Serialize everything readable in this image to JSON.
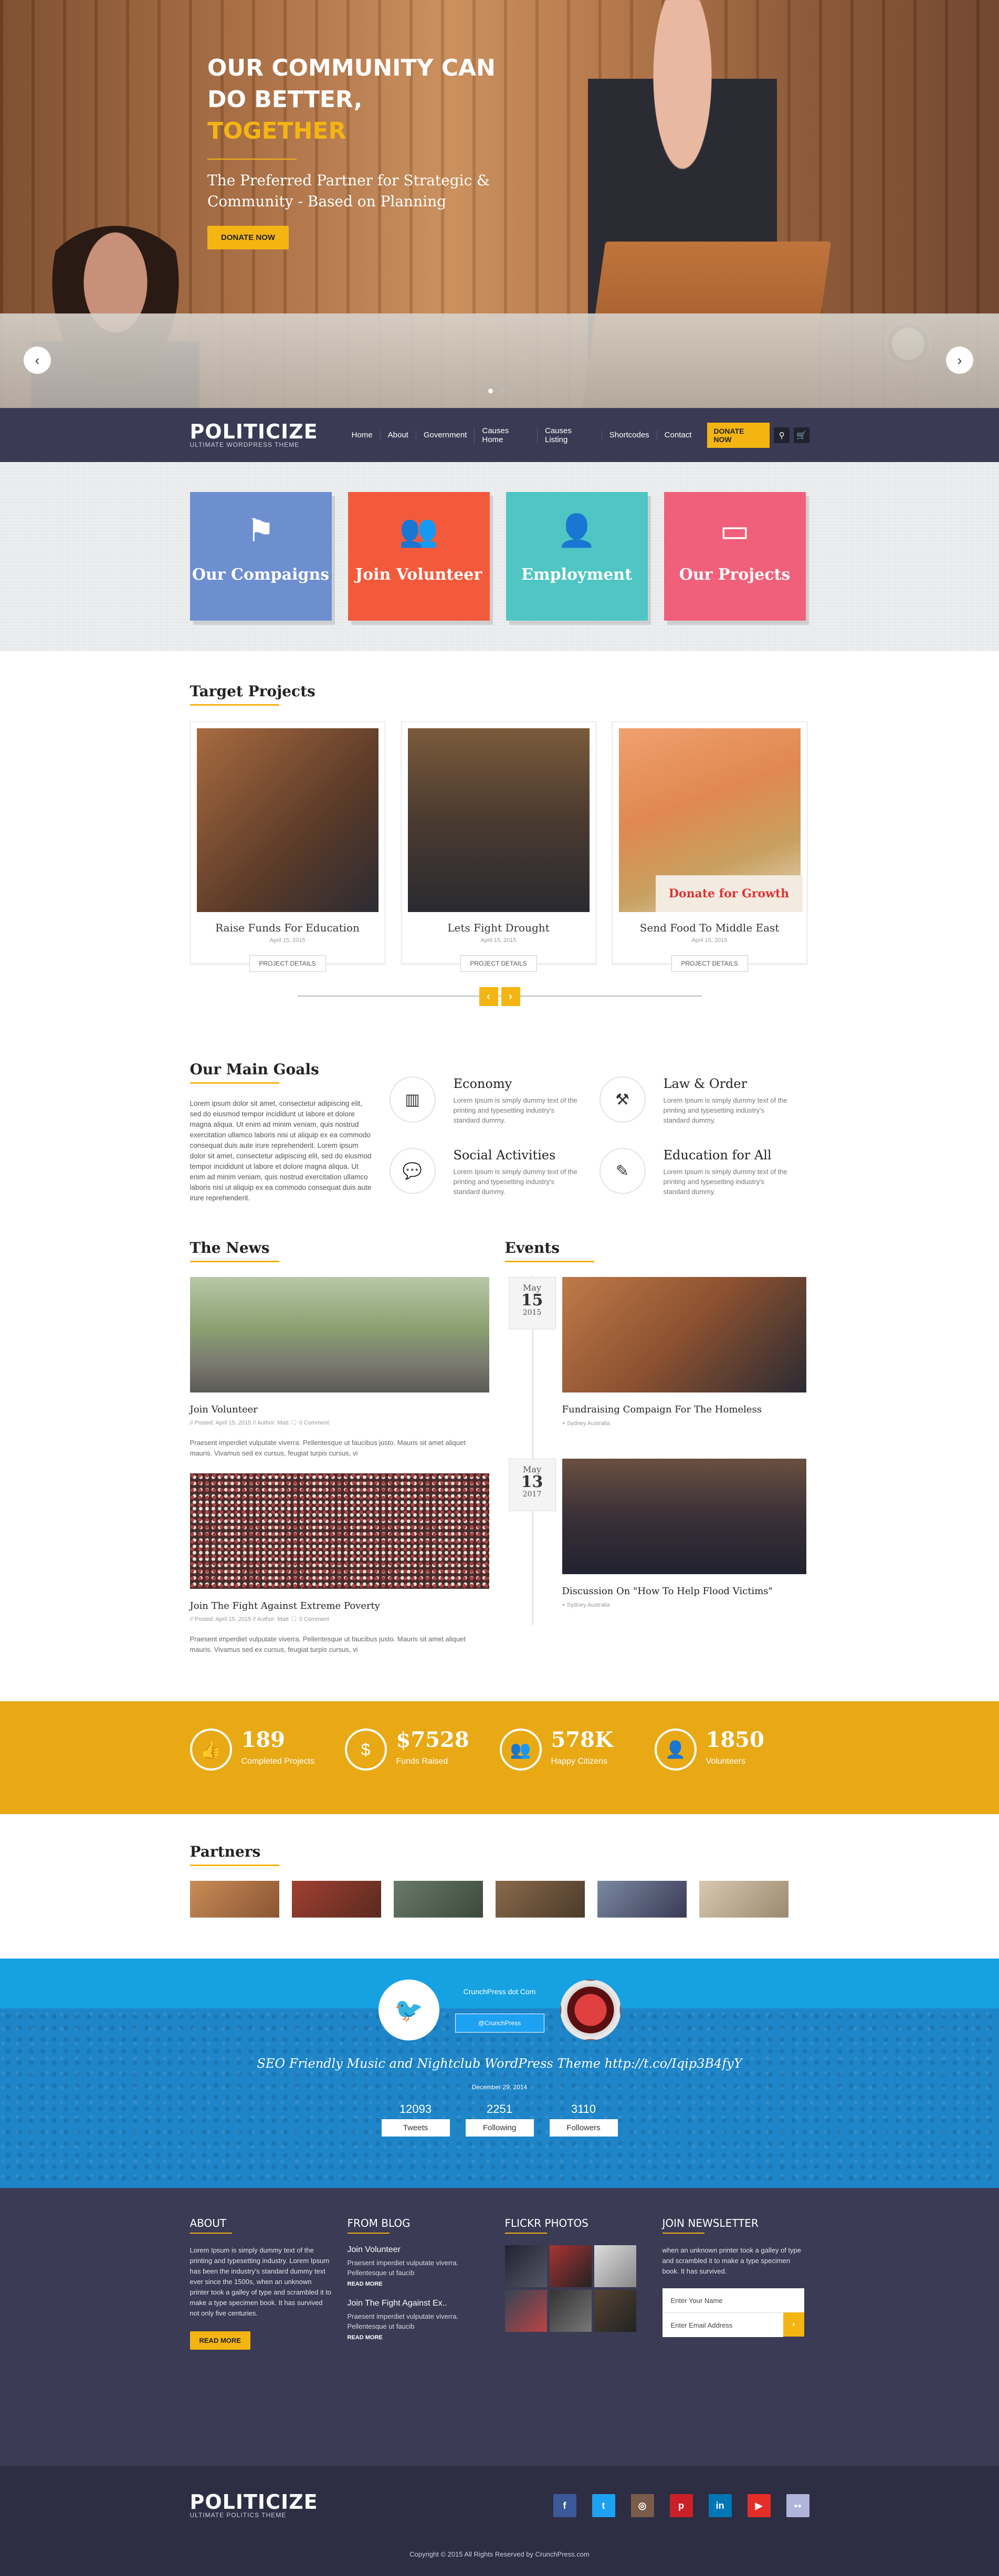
{
  "hero": {
    "title_line1": "OUR COMMUNITY CAN",
    "title_line2": "DO BETTER,",
    "title_accent": "TOGETHER",
    "subtitle": "The Preferred Partner for Strategic & Community - Based on Planning",
    "cta": "DONATE NOW",
    "prev_icon": "chevron-left-icon",
    "next_icon": "chevron-right-icon",
    "prev_glyph": "‹",
    "next_glyph": "›"
  },
  "nav": {
    "logo": "POLITICIZE",
    "tagline": "ULTIMATE WORDPRESS THEME",
    "items": [
      "Home",
      "About",
      "Government",
      "Causes Home",
      "Causes Listing",
      "Shortcodes",
      "Contact"
    ],
    "donate": "DONATE NOW",
    "search_glyph": "⚲",
    "cart_glyph": "🛒"
  },
  "features": [
    {
      "label": "Our Compaigns",
      "icon": "flag-icon",
      "glyph": "⚑",
      "color": "#6d8fd0"
    },
    {
      "label": "Join Volunteer",
      "icon": "group-icon",
      "glyph": "👥",
      "color": "#f35a3c"
    },
    {
      "label": "Employment",
      "icon": "user-tie-icon",
      "glyph": "👤",
      "color": "#4fc6c3"
    },
    {
      "label": "Our Projects",
      "icon": "credit-card-icon",
      "glyph": "▭",
      "color": "#f0607a"
    }
  ],
  "projects": {
    "title": "Target Projects",
    "items": [
      {
        "title": "Raise Funds For Education",
        "date": "April 15, 2015",
        "button": "PROJECT DETAILS"
      },
      {
        "title": "Lets Fight Drought",
        "date": "April 15, 2015",
        "button": "PROJECT DETAILS"
      },
      {
        "title": "Send Food To Middle East",
        "date": "April 15, 2015",
        "button": "PROJECT DETAILS",
        "overlay": "Donate for Growth"
      }
    ],
    "prev_glyph": "‹",
    "next_glyph": "›"
  },
  "goals": {
    "title": "Our Main Goals",
    "text": "Lorem ipsum dolor sit amet, consectetur adipiscing elit, sed do eiusmod tempor incididunt ut labore et dolore magna aliqua. Ut enim ad minim veniam, quis nostrud exercitation ullamco laboris nisi ut aliquip ex ea commodo consequat duis aute irure reprehenderit. Lorem ipsum dolor sit amet, consectetur adipiscing elit, sed do eiusmod tempor incididunt ut labore et dolore magna aliqua. Ut enim ad minim veniam, quis nostrud exercitation ullamco laboris nisi ut aliquip ex ea commodo consequat duis aute irure reprehenderit.",
    "items": [
      {
        "title": "Economy",
        "desc": "Lorem Ipsum is simply dummy text of the printing and typesetting industry's standard dummy.",
        "icon": "chart-icon",
        "glyph": "▥"
      },
      {
        "title": "Law & Order",
        "desc": "Lorem Ipsum is simply dummy text of the printing and typesetting industry's standard dummy.",
        "icon": "gavel-icon",
        "glyph": "⚒"
      },
      {
        "title": "Social Activities",
        "desc": "Lorem Ipsum is simply dummy text of the printing and typesetting industry's standard dummy.",
        "icon": "chat-icon",
        "glyph": "💬"
      },
      {
        "title": "Education for All",
        "desc": "Lorem Ipsum is simply dummy text of the printing and typesetting industry's standard dummy.",
        "icon": "pencil-icon",
        "glyph": "✎"
      }
    ]
  },
  "news": {
    "title": "The News",
    "items": [
      {
        "title": "Join Volunteer",
        "meta": "//  Posted: April 15, 2015   //  Author: Matt   🗨 0 Comment",
        "text": "Praesent imperdiet vulputate viverra. Pellentesque ut faucibus justo. Mauris sit amet aliquet mauris. Vivamus sed ex cursus, feugiat turpis cursus, vi"
      },
      {
        "title": "Join The Fight Against Extreme Poverty",
        "meta": "//  Posted: April 15, 2015   //  Author: Matt   🗨 0 Comment",
        "text": "Praesent imperdiet vulputate viverra. Pellentesque ut faucibus justo. Mauris sit amet aliquet mauris. Vivamus sed ex cursus, feugiat turpis cursus, vi"
      }
    ]
  },
  "events": {
    "title": "Events",
    "items": [
      {
        "month": "May",
        "day": "15",
        "year": "2015",
        "title": "Fundraising Compaign For The Homeless",
        "location": "Sydney Australia"
      },
      {
        "month": "May",
        "day": "13",
        "year": "2017",
        "title": "Discussion On \"How To Help Flood Victims\"",
        "location": "Sydney Australia"
      }
    ]
  },
  "stats": [
    {
      "value": "189",
      "label": "Completed Projects",
      "icon": "thumbs-up-icon",
      "glyph": "👍"
    },
    {
      "value": "$7528",
      "label": "Funds Raised",
      "icon": "money-icon",
      "glyph": "$"
    },
    {
      "value": "578K",
      "label": "Happy Citizens",
      "icon": "users-icon",
      "glyph": "👥"
    },
    {
      "value": "1850",
      "label": "Volunteers",
      "icon": "user-icon",
      "glyph": "👤"
    }
  ],
  "partners": {
    "title": "Partners"
  },
  "twitter": {
    "name": "CrunchPress dot Com",
    "handle": "@CrunchPress",
    "tweet": "SEO Friendly Music and Nightclub WordPress Theme http://t.co/Iqip3B4fyY",
    "date": "December 29, 2014",
    "bird_glyph": "🐦",
    "stats": [
      {
        "value": "12093",
        "label": "Tweets"
      },
      {
        "value": "2251",
        "label": "Following"
      },
      {
        "value": "3110",
        "label": "Followers"
      }
    ]
  },
  "footer": {
    "about_title": "ABOUT",
    "about_text": "Lorem Ipsum is simply dummy text of the printing and typesetting industry. Lorem Ipsum has been the industry's standard dummy text ever since the 1500s, when an unknown printer took a galley of type and scrambled it to make a type specimen book. It has survived not only five centuries.",
    "about_button": "READ MORE",
    "blog_title": "FROM BLOG",
    "blog": [
      {
        "title": "Join Volunteer",
        "text": "Praesent imperdiet vulputate viverra. Pellentesque ut faucib",
        "more": "READ MORE"
      },
      {
        "title": "Join The Fight Against Ex..",
        "text": "Praesent imperdiet vulputate viverra. Pellentesque ut faucib",
        "more": "READ MORE"
      }
    ],
    "flickr_title": "FLICKR PHOTOS",
    "newsletter_title": "JOIN NEWSLETTER",
    "newsletter_text": "when an unknown printer took a galley of type and scrambled it to make a type specimen book. It has survived.",
    "name_placeholder": "Enter Your Name",
    "email_placeholder": "Enter Email Address",
    "send_glyph": "›",
    "logo": "POLITICIZE",
    "tagline": "ULTIMATE POLITICS THEME",
    "socials": [
      {
        "icon": "facebook-icon",
        "glyph": "f",
        "color": "#3b5998"
      },
      {
        "icon": "twitter-icon",
        "glyph": "t",
        "color": "#1da1f2"
      },
      {
        "icon": "instagram-icon",
        "glyph": "◎",
        "color": "#7a5c4a"
      },
      {
        "icon": "pinterest-icon",
        "glyph": "p",
        "color": "#cb2027"
      },
      {
        "icon": "linkedin-icon",
        "glyph": "in",
        "color": "#0077b5"
      },
      {
        "icon": "youtube-icon",
        "glyph": "▶",
        "color": "#e52d27"
      },
      {
        "icon": "flickr-icon",
        "glyph": "●●",
        "color": "#b0b4d8"
      }
    ],
    "copyright": "Copyright © 2015 All Rights Reserved by CrunchPress.com"
  }
}
